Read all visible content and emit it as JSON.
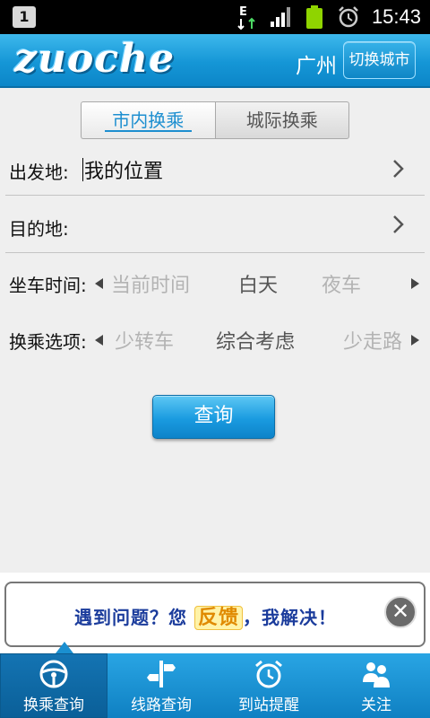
{
  "status_bar": {
    "notification_count": "1",
    "data_indicator": "E",
    "time": "15:43",
    "icons": [
      "notification-icon",
      "data-arrows-icon",
      "signal-icon",
      "battery-icon",
      "alarm-icon"
    ]
  },
  "header": {
    "logo": "zuoche",
    "city": "广州",
    "switch_city_label": "切换城市"
  },
  "tabs": [
    {
      "label": "市内换乘",
      "active": true
    },
    {
      "label": "城际换乘",
      "active": false
    }
  ],
  "form": {
    "origin": {
      "label": "出发地:",
      "value": "我的位置"
    },
    "destination": {
      "label": "目的地:",
      "value": ""
    },
    "ride_time": {
      "label": "坐车时间:",
      "options": [
        "当前时间",
        "白天",
        "夜车"
      ],
      "selected": "白天"
    },
    "transfer_option": {
      "label": "换乘选项:",
      "options": [
        "少转车",
        "综合考虑",
        "少走路"
      ],
      "selected": "综合考虑"
    },
    "query_label": "查询"
  },
  "feedback_banner": {
    "text_before": "遇到问题？您",
    "highlight": "反馈",
    "text_after": "，我解决！",
    "close_symbol": "✕"
  },
  "bottom_nav": [
    {
      "label": "换乘查询",
      "icon": "steering-wheel-icon",
      "active": true
    },
    {
      "label": "线路查询",
      "icon": "route-sign-icon",
      "active": false
    },
    {
      "label": "到站提醒",
      "icon": "alarm-clock-icon",
      "active": false
    },
    {
      "label": "关注",
      "icon": "people-icon",
      "active": false
    }
  ],
  "colors": {
    "header_blue": "#1596d6",
    "accent_blue": "#1e8fd0",
    "banner_text": "#1b3c9c",
    "banner_highlight": "#e08a00"
  }
}
